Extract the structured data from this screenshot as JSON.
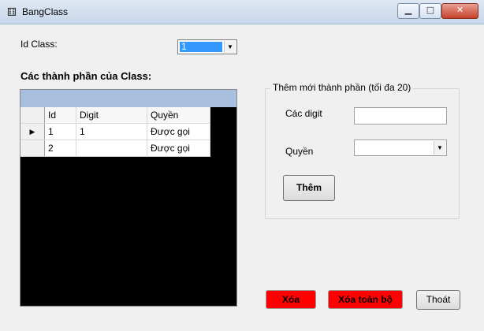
{
  "window": {
    "title": "BangClass",
    "app_icon": "dice-icon",
    "controls": {
      "minimize": "minimize-icon",
      "maximize": "maximize-icon",
      "close": "close-icon"
    }
  },
  "form": {
    "id_class_label": "Id Class:",
    "id_class_value": "1",
    "components_heading": "Các thành phần của Class:"
  },
  "grid": {
    "columns": [
      "Id",
      "Digit",
      "Quyền"
    ],
    "rows": [
      {
        "id": "1",
        "digit": "1",
        "quyen": "Được gọi",
        "current": true
      },
      {
        "id": "2",
        "digit": "",
        "quyen": "Được gọi",
        "current": false
      }
    ]
  },
  "add_group": {
    "legend": "Thêm mới thành phần (tối đa 20)",
    "digits_label": "Các digit",
    "digits_value": "",
    "permission_label": "Quyền",
    "permission_value": "",
    "add_button": "Thêm"
  },
  "actions": {
    "delete": "Xóa",
    "delete_all": "Xóa toàn bộ",
    "exit": "Thoát"
  },
  "colors": {
    "delete_button": "#ff0000",
    "grid_background": "#000000",
    "grid_caption": "#a8c0de",
    "selection": "#3399ff"
  }
}
